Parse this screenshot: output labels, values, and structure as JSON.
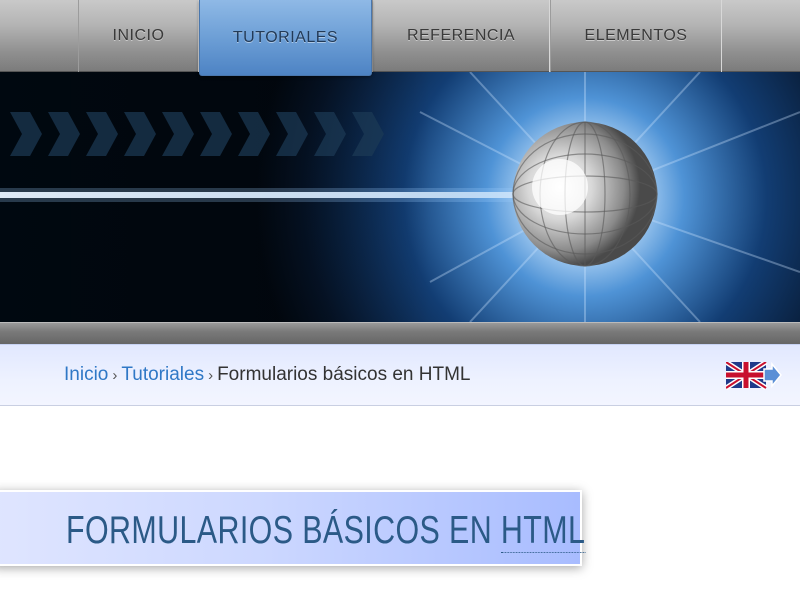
{
  "nav": {
    "items": [
      {
        "label": "INICIO"
      },
      {
        "label": "TUTORIALES"
      },
      {
        "label": "REFERENCIA"
      },
      {
        "label": "ELEMENTOS"
      }
    ]
  },
  "breadcrumb": {
    "items": [
      {
        "label": "Inicio"
      },
      {
        "label": "Tutoriales"
      },
      {
        "label": "Formularios básicos en HTML"
      }
    ],
    "separator": "›"
  },
  "language_switch": {
    "icon": "uk-flag-icon"
  },
  "page": {
    "title_main": "FORMULARIOS BÁSICOS EN ",
    "title_abbr": "HTML"
  },
  "colors": {
    "nav_active": "#6d9fd6",
    "link": "#2f78c6",
    "title": "#2b5a87",
    "crumb_bg": "#e1e8ff"
  }
}
